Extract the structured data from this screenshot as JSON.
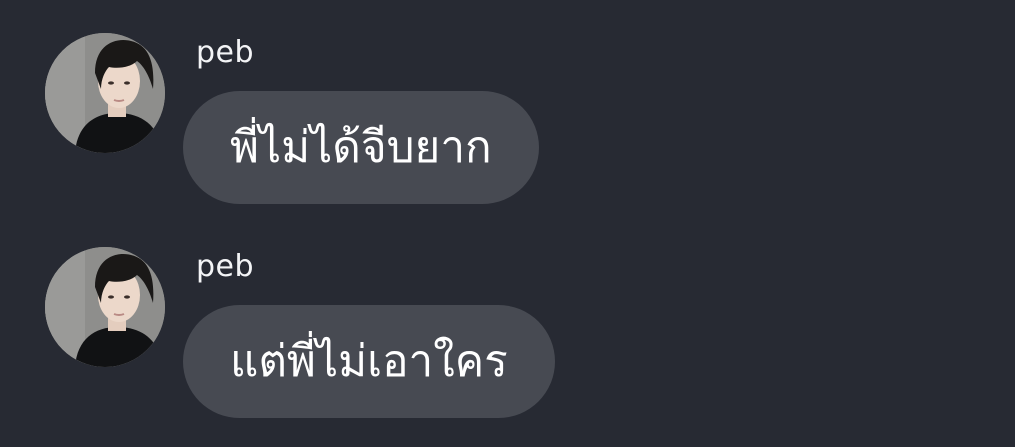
{
  "messages": [
    {
      "sender": "peb",
      "text": "พี่ไม่ได้จีบยาก"
    },
    {
      "sender": "peb",
      "text": "แต่พี่ไม่เอาใคร"
    }
  ]
}
